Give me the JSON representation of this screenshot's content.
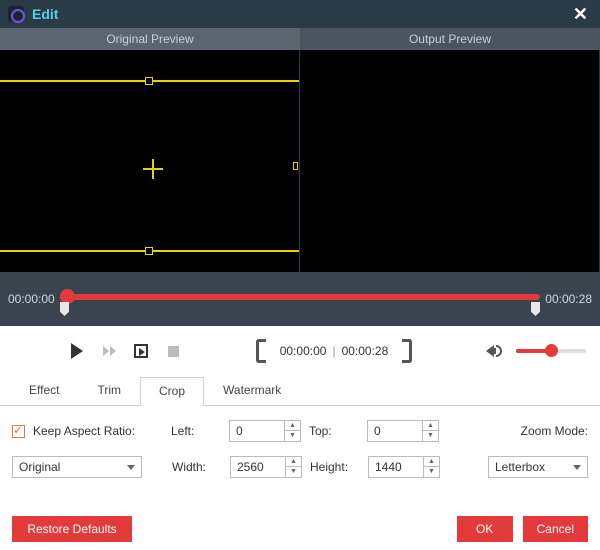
{
  "title": "Edit",
  "preview": {
    "left_label": "Original Preview",
    "right_label": "Output Preview"
  },
  "timeline": {
    "start": "00:00:00",
    "end": "00:00:28"
  },
  "playback": {
    "current": "00:00:00",
    "total": "00:00:28"
  },
  "tabs": {
    "effect": "Effect",
    "trim": "Trim",
    "crop": "Crop",
    "watermark": "Watermark"
  },
  "crop": {
    "keep_aspect": "Keep Aspect Ratio:",
    "left_lbl": "Left:",
    "left_val": "0",
    "top_lbl": "Top:",
    "top_val": "0",
    "width_lbl": "Width:",
    "width_val": "2560",
    "height_lbl": "Height:",
    "height_val": "1440",
    "zoom_lbl": "Zoom Mode:",
    "original_sel": "Original",
    "zoom_sel": "Letterbox"
  },
  "buttons": {
    "restore": "Restore Defaults",
    "ok": "OK",
    "cancel": "Cancel"
  }
}
